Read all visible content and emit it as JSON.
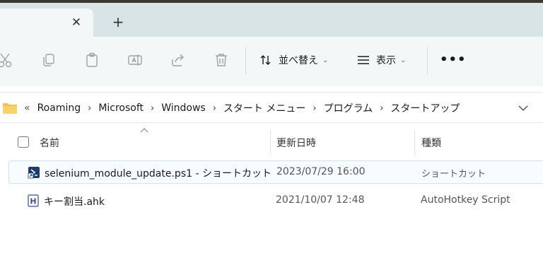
{
  "tabs": {
    "close_glyph": "✕",
    "new_glyph": "+"
  },
  "toolbar": {
    "sort_label": "並べ替え",
    "view_label": "表示",
    "chevron": "⌄",
    "more_glyph": "•••"
  },
  "address": {
    "overflow": "«",
    "separator": "›",
    "crumbs": [
      "Roaming",
      "Microsoft",
      "Windows",
      "スタート メニュー",
      "プログラム",
      "スタートアップ"
    ]
  },
  "columns": {
    "name": "名前",
    "modified": "更新日時",
    "type": "種類"
  },
  "files": [
    {
      "name": "selenium_module_update.ps1 - ショートカット",
      "modified": "2023/07/29 16:00",
      "type": "ショートカット",
      "icon": "powershell-shortcut-icon"
    },
    {
      "name": "キー割当.ahk",
      "modified": "2021/10/07 12:48",
      "type": "AutoHotkey Script",
      "icon": "autohotkey-file-icon"
    }
  ],
  "colors": {
    "tab_bar": "#d9e4e6",
    "toolbar": "#f3f7f8",
    "selection": "#cfe3f5",
    "folder": "#f2c14e"
  }
}
